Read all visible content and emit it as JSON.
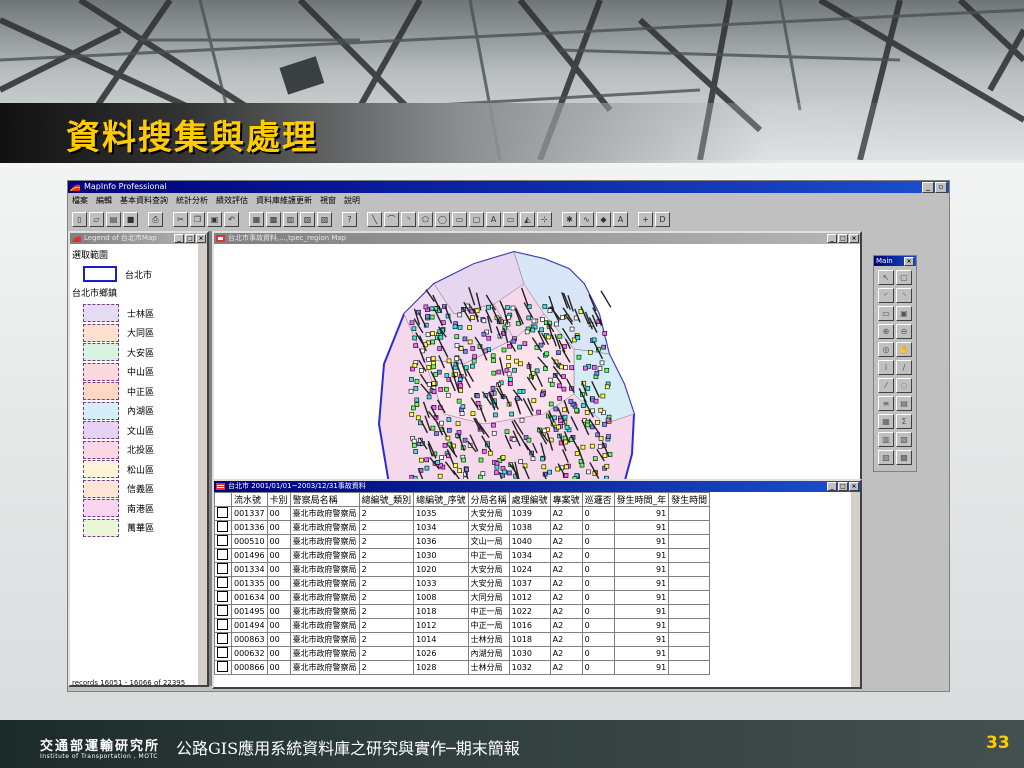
{
  "slide": {
    "title": "資料搜集與處理",
    "footer_title": "公路GIS應用系統資料庫之研究與實作─期末簡報",
    "page_number": "33",
    "org_zh": "交通部運輸研究所",
    "org_en": "Institute of Transportation , MOTC"
  },
  "app": {
    "title": "MapInfo Professional",
    "menus": [
      "檔案",
      "編輯",
      "基本資料查詢",
      "統計分析",
      "績效評估",
      "資料庫維護更新",
      "視窗",
      "說明"
    ],
    "toolbar_text": [
      "A",
      "A",
      "+",
      "D"
    ],
    "status_text": "records 16051 - 16066 of 22395"
  },
  "legend_window": {
    "title": "Legend of 台北市Map",
    "section1": "選取範圍",
    "city_label": "台北市",
    "section2": "台北市鄉鎮",
    "districts": [
      {
        "name": "士林區",
        "color": "#e3dcf2"
      },
      {
        "name": "大同區",
        "color": "#fde1cf"
      },
      {
        "name": "大安區",
        "color": "#d8f3e0"
      },
      {
        "name": "中山區",
        "color": "#fcd9dc"
      },
      {
        "name": "中正區",
        "color": "#fdd8c4"
      },
      {
        "name": "內湖區",
        "color": "#d6eef7"
      },
      {
        "name": "文山區",
        "color": "#e7d2f5"
      },
      {
        "name": "北投區",
        "color": "#fcd7e6"
      },
      {
        "name": "松山區",
        "color": "#fdf5d6"
      },
      {
        "name": "信義區",
        "color": "#fde6d6"
      },
      {
        "name": "南港區",
        "color": "#f9d6ef"
      },
      {
        "name": "萬華區",
        "color": "#e9f7d6"
      }
    ]
  },
  "map_window": {
    "title": "台北市事故資料,...,tpec_region Map"
  },
  "table_window": {
    "title": "台北市 2001/01/01~2003/12/31事故資料",
    "columns": [
      "流水號",
      "卡別",
      "警察局名稱",
      "總編號_類別",
      "總編號_序號",
      "分局名稱",
      "處理編號",
      "專案號",
      "巡邏否",
      "發生時間_年",
      "發生時間"
    ],
    "rows": [
      [
        "001337",
        "00",
        "臺北市政府警察局",
        "2",
        "1035",
        "大安分局",
        "1039",
        "A2",
        "0",
        "91"
      ],
      [
        "001336",
        "00",
        "臺北市政府警察局",
        "2",
        "1034",
        "大安分局",
        "1038",
        "A2",
        "0",
        "91"
      ],
      [
        "000510",
        "00",
        "臺北市政府警察局",
        "2",
        "1036",
        "文山一局",
        "1040",
        "A2",
        "0",
        "91"
      ],
      [
        "001496",
        "00",
        "臺北市政府警察局",
        "2",
        "1030",
        "中正一局",
        "1034",
        "A2",
        "0",
        "91"
      ],
      [
        "001334",
        "00",
        "臺北市政府警察局",
        "2",
        "1020",
        "大安分局",
        "1024",
        "A2",
        "0",
        "91"
      ],
      [
        "001335",
        "00",
        "臺北市政府警察局",
        "2",
        "1033",
        "大安分局",
        "1037",
        "A2",
        "0",
        "91"
      ],
      [
        "001634",
        "00",
        "臺北市政府警察局",
        "2",
        "1008",
        "大同分局",
        "1012",
        "A2",
        "0",
        "91"
      ],
      [
        "001495",
        "00",
        "臺北市政府警察局",
        "2",
        "1018",
        "中正一局",
        "1022",
        "A2",
        "0",
        "91"
      ],
      [
        "001494",
        "00",
        "臺北市政府警察局",
        "2",
        "1012",
        "中正一局",
        "1016",
        "A2",
        "0",
        "91"
      ],
      [
        "000863",
        "00",
        "臺北市政府警察局",
        "2",
        "1014",
        "士林分局",
        "1018",
        "A2",
        "0",
        "91"
      ],
      [
        "000632",
        "00",
        "臺北市政府警察局",
        "2",
        "1026",
        "內湖分局",
        "1030",
        "A2",
        "0",
        "91"
      ],
      [
        "000866",
        "00",
        "臺北市政府警察局",
        "2",
        "1028",
        "士林分局",
        "1032",
        "A2",
        "0",
        "91"
      ]
    ]
  },
  "tool_palette": {
    "title": "Main",
    "buttons": [
      "↖",
      "▢",
      "◜",
      "◝",
      "▭",
      "▣",
      "⊕",
      "⊖",
      "◎",
      "✋",
      "i",
      "∕",
      "⁄",
      "◌",
      "≡",
      "▤",
      "▦",
      "Σ",
      "▥",
      "▧",
      "▨",
      "▩"
    ]
  }
}
